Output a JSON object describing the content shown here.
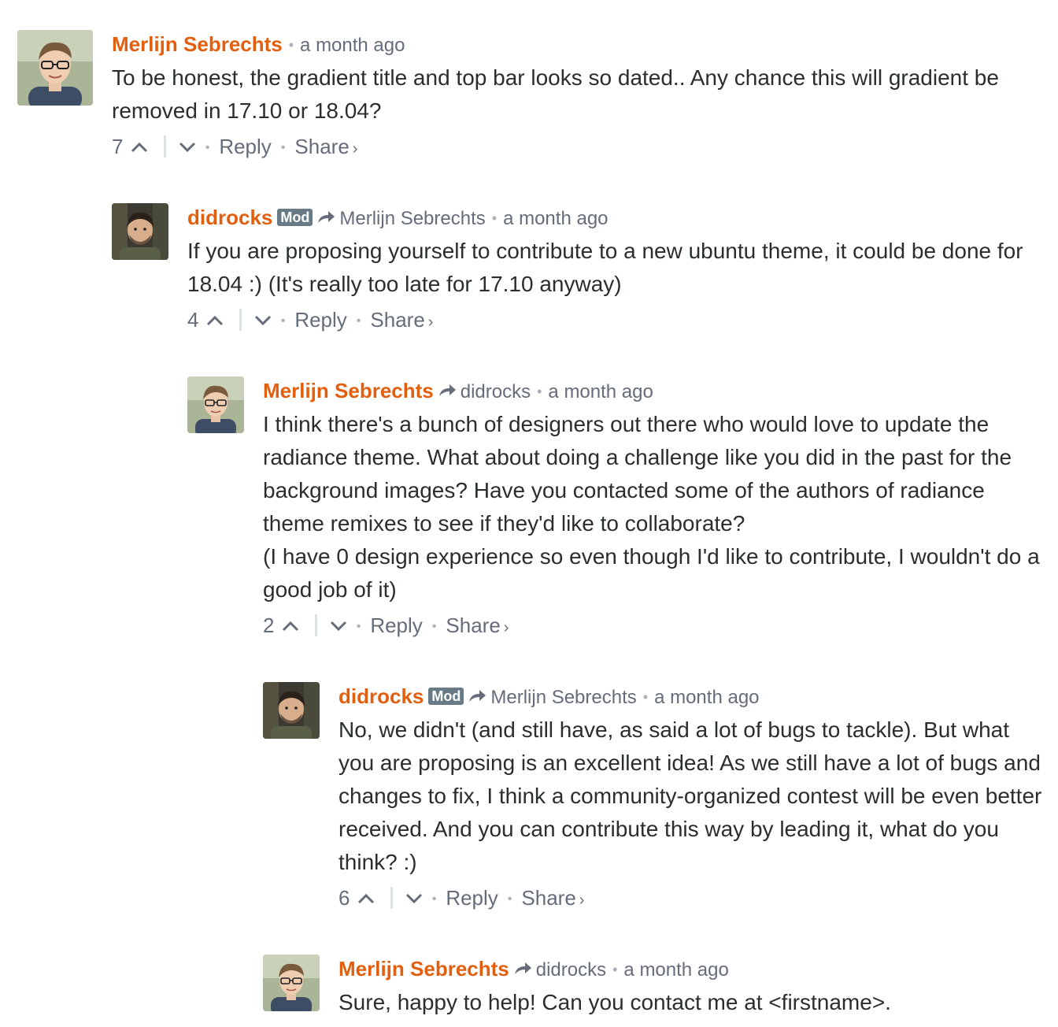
{
  "colors": {
    "author": "#e35f10",
    "meta": "#656c7a",
    "mod_badge": "#687a86",
    "text": "#2a2e2e"
  },
  "comments": [
    {
      "author": "Merlijn Sebrechts",
      "badge": "",
      "parent": "",
      "time": "a month ago",
      "text": [
        "To be honest, the gradient title and top bar looks so dated.. Any chance this will gradient be removed in 17.10 or 18.04?"
      ],
      "votes": "7",
      "reply_label": "Reply",
      "share_label": "Share",
      "avatar": "merlijn-avatar"
    },
    {
      "author": "didrocks",
      "badge": "Mod",
      "parent": "Merlijn Sebrechts",
      "time": "a month ago",
      "text": [
        "If you are proposing yourself to contribute to a new ubuntu theme, it could be done for 18.04 :) (It's really too late for 17.10 anyway)"
      ],
      "votes": "4",
      "reply_label": "Reply",
      "share_label": "Share",
      "avatar": "didrocks-avatar"
    },
    {
      "author": "Merlijn Sebrechts",
      "badge": "",
      "parent": "didrocks",
      "time": "a month ago",
      "text": [
        "I think there's a bunch of designers out there who would love to update the radiance theme. What about doing a challenge like you did in the past for the background images? Have you contacted some of the authors of radiance theme remixes to see if they'd like to collaborate?",
        "(I have 0 design experience so even though I'd like to contribute, I wouldn't do a good job of it)"
      ],
      "votes": "2",
      "reply_label": "Reply",
      "share_label": "Share",
      "avatar": "merlijn-avatar"
    },
    {
      "author": "didrocks",
      "badge": "Mod",
      "parent": "Merlijn Sebrechts",
      "time": "a month ago",
      "text": [
        "No, we didn't (and still have, as said a lot of bugs to tackle). But what you are proposing is an excellent idea! As we still have a lot of bugs and changes to fix, I think a community-organized contest will be even better received. And you can contribute this way by leading it, what do you think? :)"
      ],
      "votes": "6",
      "reply_label": "Reply",
      "share_label": "Share",
      "avatar": "didrocks-avatar"
    },
    {
      "author": "Merlijn Sebrechts",
      "badge": "",
      "parent": "didrocks",
      "time": "a month ago",
      "text": [
        "Sure, happy to help! Can you contact me at <firstname>."
      ],
      "votes": "",
      "reply_label": "",
      "share_label": "",
      "avatar": "merlijn-avatar"
    }
  ]
}
